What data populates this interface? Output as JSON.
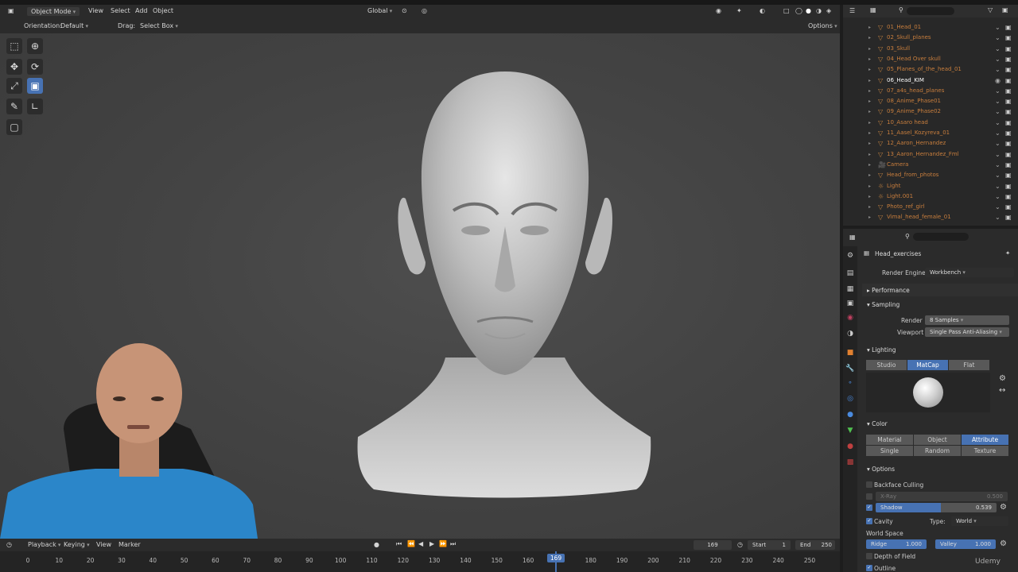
{
  "header": {
    "mode": "Object Mode",
    "menus": [
      "View",
      "Select",
      "Add",
      "Object"
    ],
    "orientation_label": "Orientation:",
    "orientation_value": "Default",
    "drag_label": "Drag:",
    "drag_value": "Select Box",
    "transform_space": "Global",
    "options": "Options"
  },
  "outliner": {
    "items": [
      {
        "name": "01_Head_01"
      },
      {
        "name": "02_Skull_planes"
      },
      {
        "name": "03_Skull"
      },
      {
        "name": "04_Head Over skull"
      },
      {
        "name": "05_Planes_of_the_head_01"
      },
      {
        "name": "06_Head_KIM"
      },
      {
        "name": "07_a4s_head_planes"
      },
      {
        "name": "08_Anime_Phase01"
      },
      {
        "name": "09_Anime_Phase02"
      },
      {
        "name": "10_Asaro head"
      },
      {
        "name": "11_Aasel_Kozyreva_01"
      },
      {
        "name": "12_Aaron_Hernandez"
      },
      {
        "name": "13_Aaron_Hernandez_Fml"
      },
      {
        "name": "Camera"
      },
      {
        "name": "Head_from_photos"
      },
      {
        "name": "Light"
      },
      {
        "name": "Light.001"
      },
      {
        "name": "Photo_ref_girl"
      },
      {
        "name": "Vimal_head_female_01"
      }
    ]
  },
  "properties": {
    "scene_name": "Head_exercises",
    "render_engine_label": "Render Engine",
    "render_engine": "Workbench",
    "performance": "Performance",
    "sampling": "Sampling",
    "render_label": "Render",
    "render_value": "8 Samples",
    "viewport_label": "Viewport",
    "viewport_value": "Single Pass Anti-Aliasing",
    "lighting": "Lighting",
    "lighting_modes": [
      "Studio",
      "MatCap",
      "Flat"
    ],
    "color": "Color",
    "color_row1": [
      "Material",
      "Object",
      "Attribute"
    ],
    "color_row2": [
      "Single",
      "Random",
      "Texture"
    ],
    "options": "Options",
    "backface": "Backface Culling",
    "xray": "X-Ray",
    "xray_value": "0.500",
    "shadow": "Shadow",
    "shadow_value": "0.539",
    "cavity": "Cavity",
    "type_label": "Type:",
    "type_value": "World",
    "world_space": "World Space",
    "ridge": "Ridge",
    "ridge_value": "1.000",
    "valley": "Valley",
    "valley_value": "1.000",
    "dof": "Depth of Field",
    "outline": "Outline"
  },
  "timeline": {
    "menus": [
      "Playback",
      "Keying",
      "View",
      "Marker"
    ],
    "current_frame": "169",
    "start_label": "Start",
    "start": "1",
    "end_label": "End",
    "end": "250",
    "ticks": [
      "0",
      "10",
      "20",
      "30",
      "40",
      "50",
      "60",
      "70",
      "80",
      "90",
      "100",
      "110",
      "120",
      "130",
      "140",
      "150",
      "160",
      "169",
      "180",
      "190",
      "200",
      "210",
      "220",
      "230",
      "240",
      "250"
    ],
    "playhead_label": "169"
  },
  "watermark": "Udemy",
  "colors": {
    "accent": "#4772b3",
    "panel": "#2b2b2b",
    "viewport": "#454545"
  }
}
